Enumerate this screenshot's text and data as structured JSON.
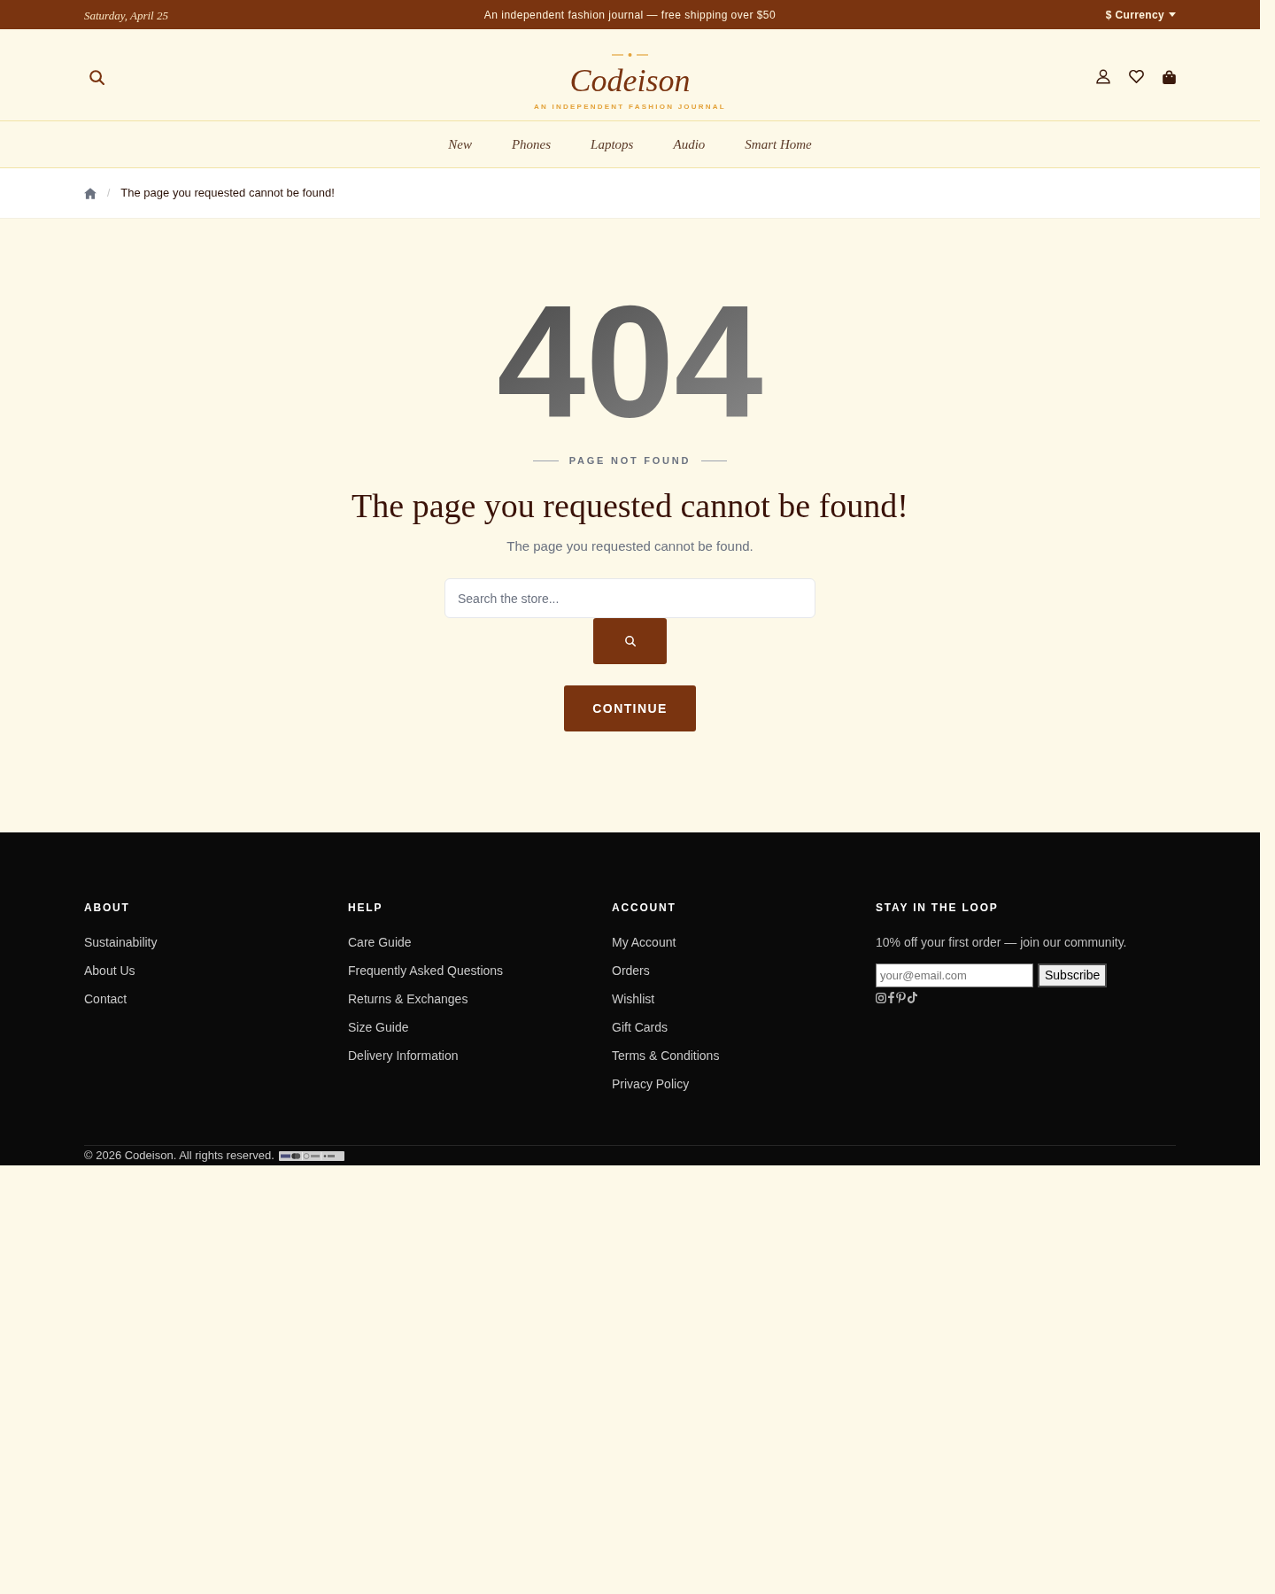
{
  "top_bar": {
    "date": "Saturday, April 25",
    "announcement": "An independent fashion journal — free shipping over $50",
    "currency": "$ Currency"
  },
  "header": {
    "logo": "Codeison",
    "tagline": "AN INDEPENDENT FASHION JOURNAL"
  },
  "nav": [
    "New",
    "Phones",
    "Laptops",
    "Audio",
    "Smart Home"
  ],
  "breadcrumb": {
    "separator": "/",
    "current": "The page you requested cannot be found!"
  },
  "error": {
    "code": "404",
    "eyebrow": "PAGE NOT FOUND",
    "title": "The page you requested cannot be found!",
    "message": "The page you requested cannot be found.",
    "search": {
      "placeholder": "Search the store..."
    },
    "continue_button": "CONTINUE"
  },
  "footer": {
    "columns": [
      {
        "heading": "ABOUT",
        "links": [
          "Sustainability",
          "About Us",
          "Contact"
        ]
      },
      {
        "heading": "HELP",
        "links": [
          "Care Guide",
          "Frequently Asked Questions",
          "Returns & Exchanges",
          "Size Guide",
          "Delivery Information"
        ]
      },
      {
        "heading": "ACCOUNT",
        "links": [
          "My Account",
          "Orders",
          "Wishlist",
          "Gift Cards",
          "Terms & Conditions",
          "Privacy Policy"
        ]
      }
    ],
    "newsletter": {
      "heading": "STAY IN THE LOOP",
      "text": "10% off your first order — join our community.",
      "email": {
        "placeholder": "your@email.com"
      },
      "button": "Subscribe"
    },
    "copyright": "© 2026 Codeison. All rights reserved."
  }
}
